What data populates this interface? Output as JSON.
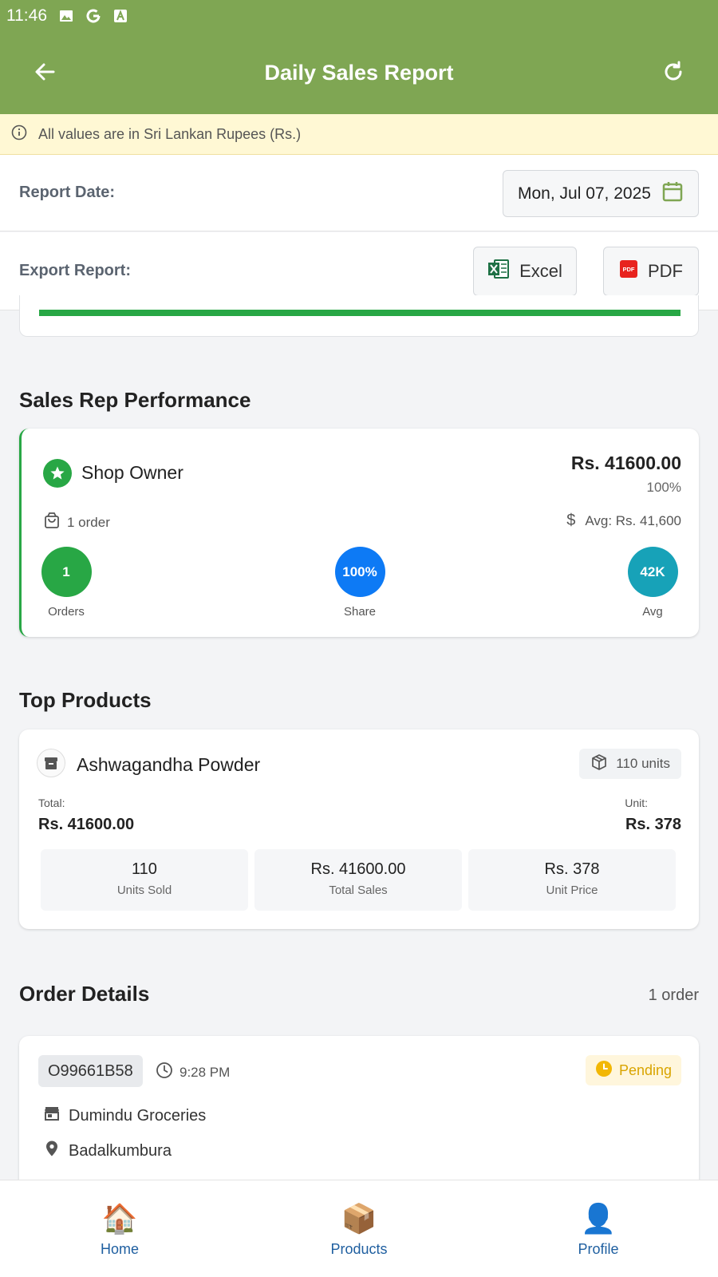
{
  "status_bar": {
    "time": "11:46"
  },
  "app_bar": {
    "title": "Daily Sales Report"
  },
  "info_banner": {
    "text": "All values are in Sri Lankan Rupees (Rs.)"
  },
  "report_date": {
    "label": "Report Date:",
    "value": "Mon, Jul 07, 2025"
  },
  "export": {
    "label": "Export Report:",
    "excel_label": "Excel",
    "pdf_label": "PDF"
  },
  "top_progress": {
    "percent": 100,
    "text": "100%"
  },
  "sales_rep_section": {
    "title": "Sales Rep Performance",
    "rep": {
      "name": "Shop Owner",
      "total": "Rs. 41600.00",
      "percent": "100%",
      "orders_text": "1 order",
      "avg_text": "Avg: Rs. 41,600",
      "metrics": [
        {
          "value": "1",
          "label": "Orders",
          "color": "#28a745"
        },
        {
          "value": "100%",
          "label": "Share",
          "color": "#0d7af5"
        },
        {
          "value": "42K",
          "label": "Avg",
          "color": "#17a2b8"
        }
      ]
    }
  },
  "top_products_section": {
    "title": "Top Products",
    "product": {
      "name": "Ashwagandha Powder",
      "units_badge": "110 units",
      "total_label": "Total:",
      "total_value": "Rs. 41600.00",
      "unit_label": "Unit:",
      "unit_value": "Rs. 378",
      "stats": [
        {
          "value": "110",
          "label": "Units Sold"
        },
        {
          "value": "Rs. 41600.00",
          "label": "Total Sales"
        },
        {
          "value": "Rs. 378",
          "label": "Unit Price"
        }
      ]
    }
  },
  "order_details_section": {
    "title": "Order Details",
    "count": "1 order",
    "order": {
      "id": "O99661B58",
      "time": "9:28 PM",
      "status": "Pending",
      "shop": "Dumindu Groceries",
      "location": "Badalkumbura"
    }
  },
  "bottom_nav": [
    {
      "label": "Home",
      "icon": "house-emoji"
    },
    {
      "label": "Products",
      "icon": "package-emoji"
    },
    {
      "label": "Profile",
      "icon": "person-emoji"
    }
  ],
  "colors": {
    "primary": "#7fa653",
    "success": "#28a745",
    "info": "#17a2b8",
    "blue": "#0d7af5",
    "pending": "#d9a400"
  }
}
